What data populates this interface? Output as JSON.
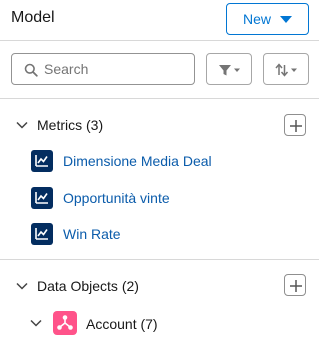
{
  "header": {
    "title": "Model",
    "new_button": "New"
  },
  "search": {
    "placeholder": "Search"
  },
  "metrics": {
    "label": "Metrics (3)",
    "items": [
      {
        "label": "Dimensione Media Deal",
        "icon": "metric-chart-icon"
      },
      {
        "label": "Opportunità vinte",
        "icon": "metric-chart-icon"
      },
      {
        "label": "Win Rate",
        "icon": "metric-chart-icon"
      }
    ]
  },
  "data_objects": {
    "label": "Data Objects (2)",
    "items": [
      {
        "label": "Account (7)",
        "icon": "object-node-icon"
      }
    ]
  },
  "colors": {
    "brand": "#0176d3",
    "metric_icon_bg": "#032d60",
    "metric_link": "#0b5cab",
    "object_icon_bg": "#ff538a"
  }
}
